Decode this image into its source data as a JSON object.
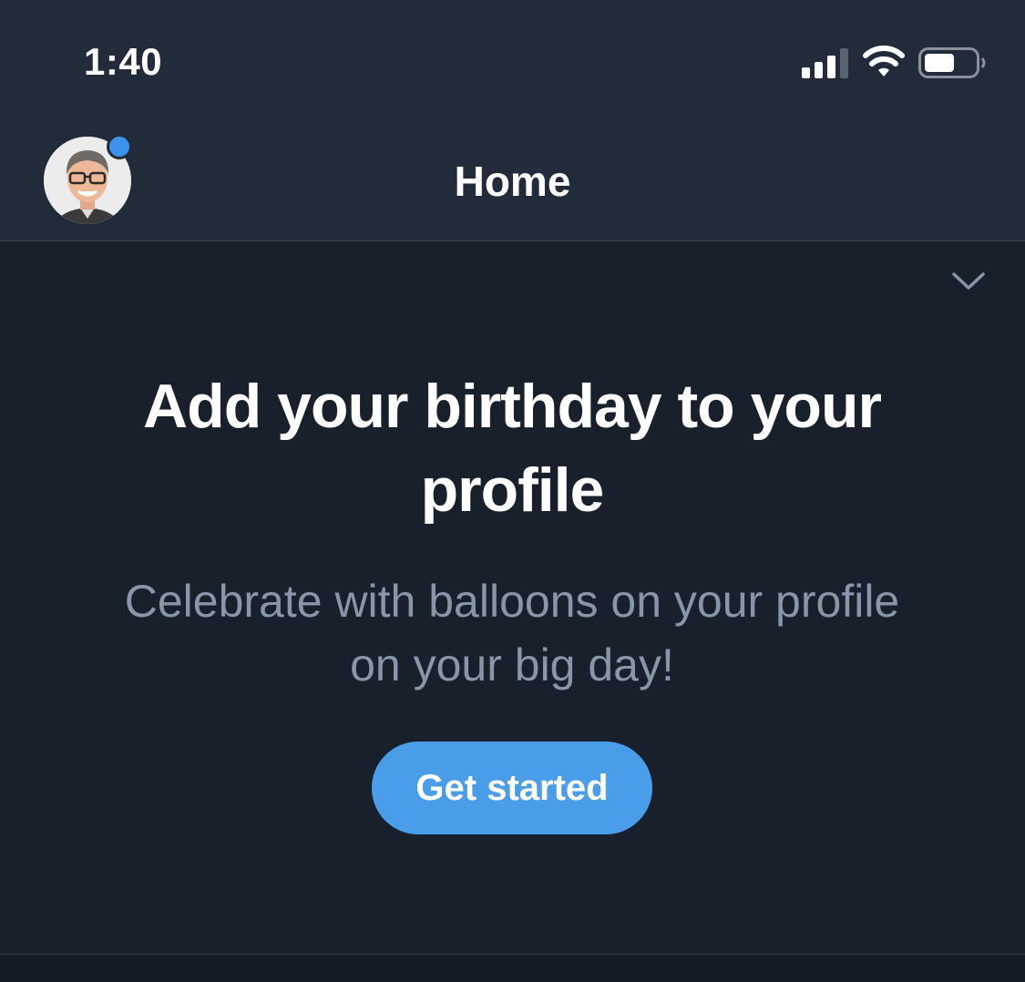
{
  "status_bar": {
    "time": "1:40",
    "signal_icon": "cellular-signal-icon",
    "wifi_icon": "wifi-icon",
    "battery_icon": "battery-icon"
  },
  "nav": {
    "title": "Home",
    "avatar_icon": "profile-avatar",
    "notification_dot_color": "#3d93ec"
  },
  "prompt": {
    "collapse_icon": "chevron-down-icon",
    "title": "Add your birthday to your profile",
    "subtitle": "Celebrate with balloons on your profile on your big day!",
    "button_label": "Get started"
  },
  "colors": {
    "header_bg": "#212b3a",
    "body_bg": "#18202b",
    "accent": "#4a9de8",
    "subtitle_text": "#8796a8"
  }
}
